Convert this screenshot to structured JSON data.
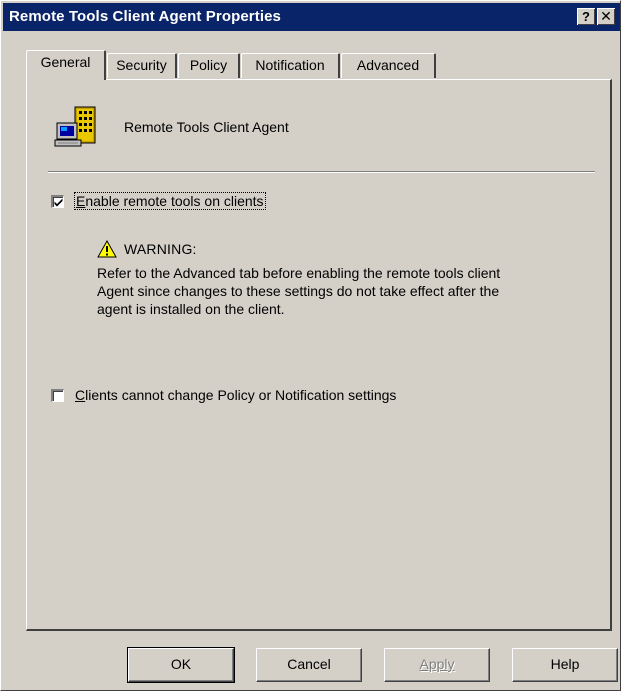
{
  "window": {
    "title": "Remote Tools Client Agent Properties",
    "help_glyph": "?",
    "close_glyph": "✕"
  },
  "tabs": [
    {
      "label": "General",
      "active": true
    },
    {
      "label": "Security",
      "active": false
    },
    {
      "label": "Policy",
      "active": false
    },
    {
      "label": "Notification",
      "active": false
    },
    {
      "label": "Advanced",
      "active": false
    }
  ],
  "general": {
    "agent_name": "Remote Tools Client Agent",
    "enable_checkbox": {
      "label_accel": "E",
      "label_rest": "nable remote tools on clients",
      "checked": true
    },
    "warning": {
      "title": "WARNING:",
      "lines": [
        "Refer to the Advanced tab before enabling the remote tools client",
        "Agent since changes to these settings do not take effect after the",
        "agent is installed on the client."
      ]
    },
    "policy_checkbox": {
      "label_accel": "C",
      "label_rest": "lients cannot change Policy or Notification settings",
      "checked": false
    }
  },
  "buttons": {
    "ok": "OK",
    "cancel": "Cancel",
    "apply": "Apply",
    "help": "Help"
  },
  "colors": {
    "titlebar": "#0a246a",
    "face": "#d4d0c8"
  },
  "icons": {
    "agent": "computer-building-icon",
    "warning": "warning-triangle-icon"
  }
}
